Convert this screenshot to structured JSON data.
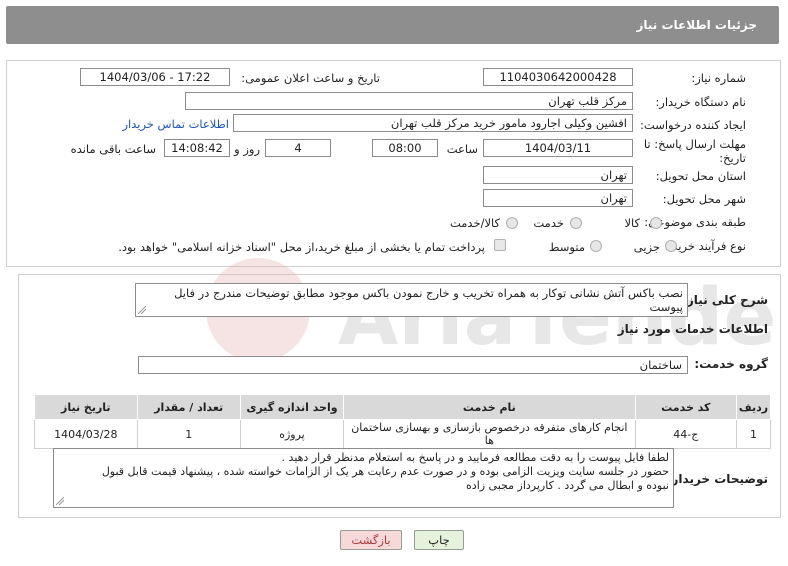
{
  "header": {
    "title": "جزئیات اطلاعات نیاز"
  },
  "form": {
    "need_number_label": "شماره نیاز:",
    "need_number": "1104030642000428",
    "announce_datetime_label": "تاریخ و ساعت اعلان عمومی:",
    "announce_datetime": "1404/03/06 - 17:22",
    "buyer_org_label": "نام دستگاه خریدار:",
    "buyer_org": "مرکز قلب تهران",
    "requester_label": "ایجاد کننده درخواست:",
    "requester": "افشین وکیلی اجارود مامور خرید مرکز قلب تهران",
    "contact_link": "اطلاعات تماس خریدار",
    "deadline_label_line1": "مهلت ارسال پاسخ: تا",
    "deadline_label_line2": "تاریخ:",
    "deadline_date": "1404/03/11",
    "time_label": "ساعت",
    "deadline_time": "08:00",
    "days_value": "4",
    "days_label": "روز و",
    "remaining_time": "14:08:42",
    "remaining_label": "ساعت باقی مانده",
    "province_label": "استان محل تحویل:",
    "province": "تهران",
    "city_label": "شهر محل تحویل:",
    "city": "تهران",
    "category_label": "طبقه بندی موضوعی:",
    "category_options": [
      "کالا",
      "خدمت",
      "کالا/خدمت"
    ],
    "process_label": "نوع فرآیند خرید :",
    "process_options": [
      "جزیی",
      "متوسط"
    ],
    "payment_note": "پرداخت تمام یا بخشی از مبلغ خرید،از محل \"اسناد خزانه اسلامی\" خواهد بود."
  },
  "description": {
    "label": "شرح کلی نیاز:",
    "text": "نصب باکس آتش نشانی توکار به همراه تخریب و خارج نمودن باکس موجود مطابق توضیحات مندرج در فایل پیوست"
  },
  "services": {
    "section_title": "اطلاعات خدمات مورد نیاز",
    "group_label": "گروه خدمت:",
    "group_value": "ساختمان",
    "columns": [
      "ردیف",
      "کد خدمت",
      "نام خدمت",
      "واحد اندازه گیری",
      "تعداد / مقدار",
      "تاریخ نیاز"
    ],
    "rows": [
      [
        "1",
        "ج-44",
        "انجام کارهای متفرقه درخصوص بازسازی و بهسازی ساختمان ها",
        "پروژه",
        "1",
        "1404/03/28"
      ]
    ]
  },
  "buyer_notes": {
    "label": "توضیحات خریدار:",
    "lines": [
      "لطفا فایل پیوست را به دقت مطالعه فرمایید و در پاسخ به استعلام مدنظر قرار دهید .",
      "حضور در جلسه سایت ویزیت الزامی بوده و در صورت عدم رعایت هر یک از الزامات خواسته شده ، پیشنهاد قیمت قابل قبول",
      "نبوده و ابطال می گردد . کارپرداز مجبی زاده"
    ]
  },
  "buttons": {
    "print": "چاپ",
    "back": "بازگشت"
  },
  "watermark": {
    "text": "AriaTender.neT"
  },
  "colors": {
    "header_bg": "#8e8e8e",
    "link": "#1a55c9",
    "back_btn_bg": "#f7d9d9",
    "print_btn_bg": "#e6f3dc",
    "table_head": "#d9d9d9"
  }
}
